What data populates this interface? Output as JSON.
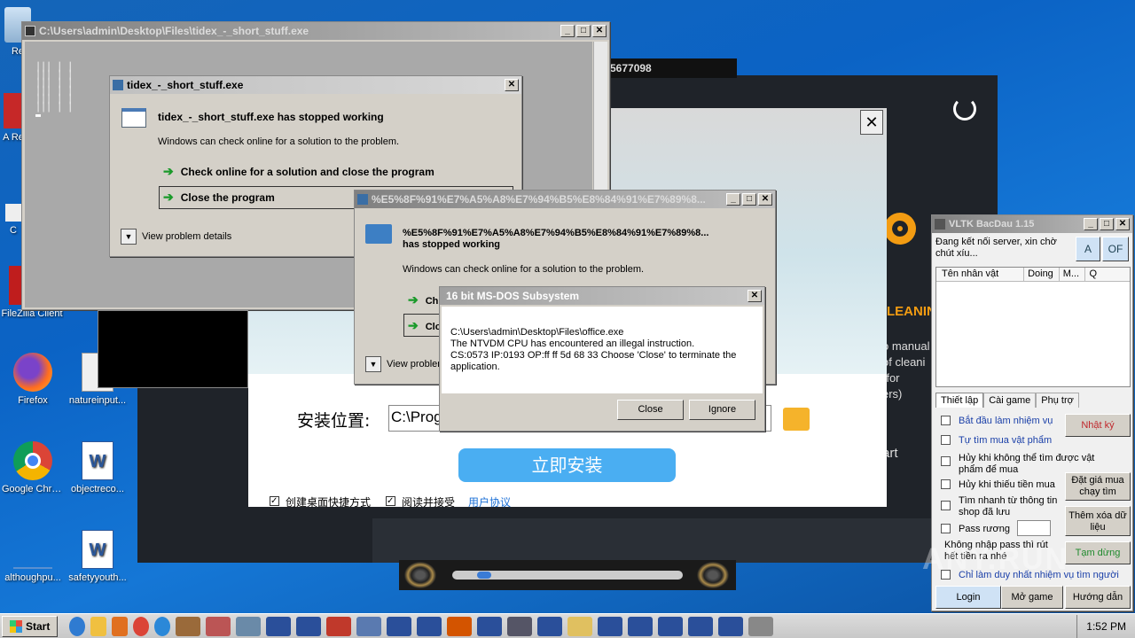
{
  "desktop": {
    "icons": [
      {
        "label": "Re"
      },
      {
        "label": "A\nRe"
      },
      {
        "label": "C"
      },
      {
        "label": "FileZilla Client"
      },
      {
        "label": "Firefox"
      },
      {
        "label": "natureinput..."
      },
      {
        "label": "Google Chrome"
      },
      {
        "label": "objectreco..."
      },
      {
        "label": "althoughpu..."
      },
      {
        "label": "safetyyouth..."
      }
    ]
  },
  "console_window": {
    "title": "C:\\Users\\admin\\Desktop\\Files\\tidex_-_short_stuff.exe"
  },
  "dialog1": {
    "title": "tidex_-_short_stuff.exe",
    "heading": "tidex_-_short_stuff.exe has stopped working",
    "message": "Windows can check online for a solution to the problem.",
    "option1": "Check online for a solution and close the program",
    "option2": "Close the program",
    "details": "View problem details"
  },
  "dialog2": {
    "title": "%E5%8F%91%E7%A5%A8%E7%94%B5%E8%84%91%E7%89%8...",
    "heading_line1": "%E5%8F%91%E7%A5%A8%E7%94%B5%E8%84%91%E7%89%8...",
    "heading_line2": "has stopped working",
    "message": "Windows can check online for a solution to the problem.",
    "option1": "Ch",
    "option2": "Clo",
    "details": "View problem"
  },
  "dos_dialog": {
    "title": "16 bit MS-DOS Subsystem",
    "line1": "C:\\Users\\admin\\Desktop\\Files\\office.exe",
    "line2": "The NTVDM CPU has encountered an illegal instruction.",
    "line3": "CS:0573 IP:0193 OP:ff ff 5d 68 33 Choose 'Close' to terminate the",
    "line4": "application.",
    "close_label": "Close",
    "ignore_label": "Ignore"
  },
  "installer": {
    "location_label": "安装位置:",
    "path_value": "C:\\Prog",
    "install_button": "立即安装",
    "checkbox1": "创建桌面快捷方式",
    "checkbox2": "阅读并接受",
    "agreement_link": "用户协议"
  },
  "cleaner": {
    "title_fragment": "LEANIN",
    "text_lines": [
      "o manual",
      "of cleani",
      "(for",
      "ers)"
    ],
    "start_fragment": "art",
    "number_fragment": "5677098"
  },
  "vltk": {
    "title": "VLTK BacDau 1.15",
    "status": "Đang kết nối server, xin chờ chút xíu...",
    "btn_a": "A",
    "btn_of": "OF",
    "columns": [
      "Tên nhân vật",
      "Doing",
      "M...",
      "Q"
    ],
    "tabs": [
      "Thiết lập",
      "Cài game",
      "Phụ trợ"
    ],
    "options": [
      {
        "label": "Bắt đầu làm nhiệm vụ"
      },
      {
        "label": "Tự tìm mua vật phẩm"
      },
      {
        "label": "Hủy khi không thể tìm được vật phẩm để mua"
      },
      {
        "label": "Hủy khi thiếu tiền mua"
      },
      {
        "label": "Tìm nhanh từ thông tin shop đã lưu"
      },
      {
        "label": "Pass rương"
      }
    ],
    "note": "Không nhập pass thì rút hết tiền ra nhé",
    "last_option": "Chỉ làm duy nhất nhiệm vụ tìm người",
    "side_buttons": [
      "Nhật ký",
      "Đặt giá mua chạy tìm",
      "Thêm xóa dữ liệu",
      "Tạm dừng"
    ],
    "bottom_buttons": [
      "Login",
      "Mở game",
      "Hướng dẫn"
    ]
  },
  "taskbar": {
    "start_label": "Start",
    "time": "1:52 PM"
  },
  "watermark": "ANY.RUN",
  "colors": {
    "taskbar": "#d4d0c8",
    "install_button": "#4aaef2",
    "accent_orange": "#f39c12"
  }
}
